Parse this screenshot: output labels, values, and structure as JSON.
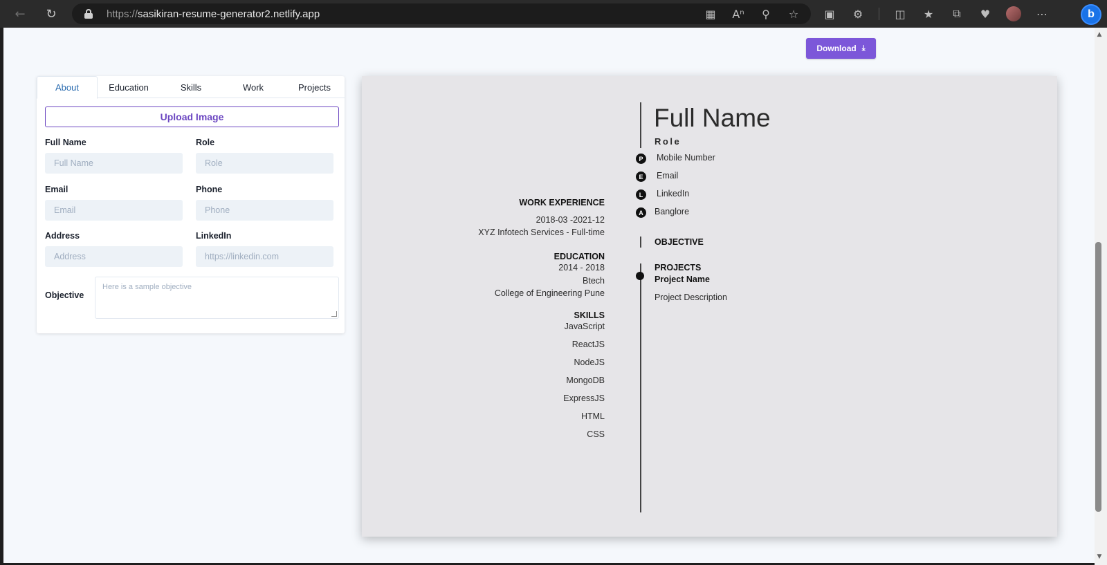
{
  "browser": {
    "url_protocol": "https://",
    "url_host": "sasikiran-resume-generator2.netlify.app",
    "profile_initial": "b"
  },
  "toolbar": {
    "download_label": "Download"
  },
  "form": {
    "tabs": [
      "About",
      "Education",
      "Skills",
      "Work",
      "Projects"
    ],
    "active_tab": "About",
    "upload_label": "Upload Image",
    "fields": {
      "full_name": {
        "label": "Full Name",
        "placeholder": "Full Name"
      },
      "role": {
        "label": "Role",
        "placeholder": "Role"
      },
      "email": {
        "label": "Email",
        "placeholder": "Email"
      },
      "phone": {
        "label": "Phone",
        "placeholder": "Phone"
      },
      "address": {
        "label": "Address",
        "placeholder": "Address"
      },
      "linkedin": {
        "label": "LinkedIn",
        "placeholder": "https://linkedin.com"
      },
      "objective": {
        "label": "Objective",
        "placeholder": "Here is a sample objective"
      }
    }
  },
  "resume": {
    "name": "Full Name",
    "role": "Role",
    "contacts": [
      {
        "icon": "P",
        "text": "Mobile Number"
      },
      {
        "icon": "E",
        "text": "Email"
      },
      {
        "icon": "L",
        "text": "LinkedIn"
      },
      {
        "icon": "A",
        "text": "Banglore"
      }
    ],
    "work": {
      "heading": "WORK EXPERIENCE",
      "period": "2018-03 -2021-12",
      "company": "XYZ Infotech Services - Full-time"
    },
    "education": {
      "heading": "EDUCATION",
      "period": "2014 - 2018",
      "degree": "Btech",
      "college": "College of Engineering Pune"
    },
    "skills": {
      "heading": "SKILLS",
      "items": [
        "JavaScript",
        "ReactJS",
        "NodeJS",
        "MongoDB",
        "ExpressJS",
        "HTML",
        "CSS"
      ]
    },
    "objective_heading": "OBJECTIVE",
    "projects": {
      "heading": "PROJECTS",
      "name": "Project Name",
      "description": "Project Description"
    }
  }
}
